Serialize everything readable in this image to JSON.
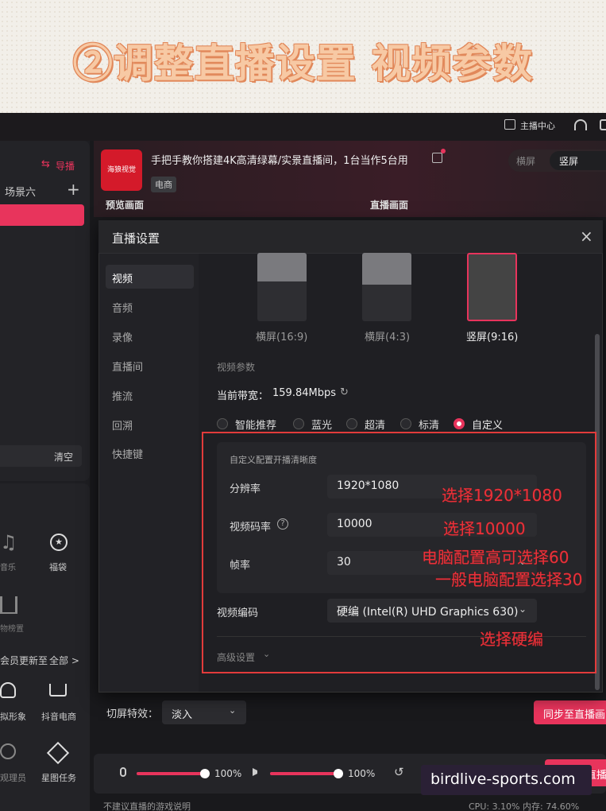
{
  "banner": {
    "title": "②调整直播设置 视频参数"
  },
  "topbar": {
    "studio_label": "主播中心"
  },
  "sidebar": {
    "guide_label": "导播",
    "scene_label": "场景六",
    "clear_label": "清空",
    "tools": [
      {
        "label": "音乐",
        "icon": "music-icon"
      },
      {
        "label": "福袋",
        "icon": "gift-bag-icon"
      },
      {
        "label": "物榜置",
        "icon": "chart-icon"
      }
    ],
    "member_text": "会员更新至",
    "all_label": "全部 >",
    "bottom_tools": [
      {
        "label": "拟形象",
        "icon": "avatar-icon"
      },
      {
        "label": "抖音电商",
        "icon": "cart-icon"
      },
      {
        "label": "观理员",
        "icon": "user-admin-icon"
      },
      {
        "label": "星图任务",
        "icon": "task-icon"
      }
    ]
  },
  "header": {
    "logo_text": "海狼视觉",
    "stream_title": "手把手教你搭建4K高清绿幕/实景直播间，1台当作5台用",
    "tag": "电商",
    "landscape_label": "横屏",
    "portrait_label": "竖屏",
    "preview_label": "预览画面",
    "live_label": "直播画面"
  },
  "modal": {
    "title": "直播设置",
    "nav": [
      "视频",
      "音频",
      "录像",
      "直播间",
      "推流",
      "回溯",
      "快捷键"
    ],
    "orientations": [
      "横屏(16:9)",
      "横屏(4:3)",
      "竖屏(9:16)"
    ],
    "section_label": "视频参数",
    "bandwidth_label": "当前带宽：",
    "bandwidth_value": "159.84Mbps",
    "quality_options": [
      "智能推荐",
      "蓝光",
      "超清",
      "标清",
      "自定义"
    ],
    "quality_selected": "自定义",
    "custom_label": "自定义配置开播清晰度",
    "resolution_label": "分辨率",
    "resolution_value": "1920*1080",
    "bitrate_label": "视频码率",
    "bitrate_value": "10000",
    "fps_label": "帧率",
    "fps_value": "30",
    "encoder_label": "视频编码",
    "encoder_value": "硬编 (Intel(R) UHD Graphics 630)",
    "advanced_label": "高级设置"
  },
  "annotations": {
    "resolution": "选择1920*1080",
    "bitrate": "选择10000",
    "fps_line1": "电脑配置高可选择60",
    "fps_line2": "一般电脑配置选择30",
    "encoder": "选择硬编"
  },
  "below_modal": {
    "transition_label": "切屏特效：",
    "transition_value": "淡入",
    "sync_button": "同步至直播画"
  },
  "bottombar": {
    "mic_volume": "100%",
    "speaker_volume": "100%",
    "mic_level": 0.98,
    "speaker_level": 0.98,
    "start_label": "开始直播",
    "footer_left": "不建议直播的游戏说明",
    "footer_right": "CPU: 3.10%    内存: 74.60%"
  },
  "watermark": "birdlive-sports.com",
  "colors": {
    "accent": "#e8345c",
    "annotation": "#e8313a"
  }
}
